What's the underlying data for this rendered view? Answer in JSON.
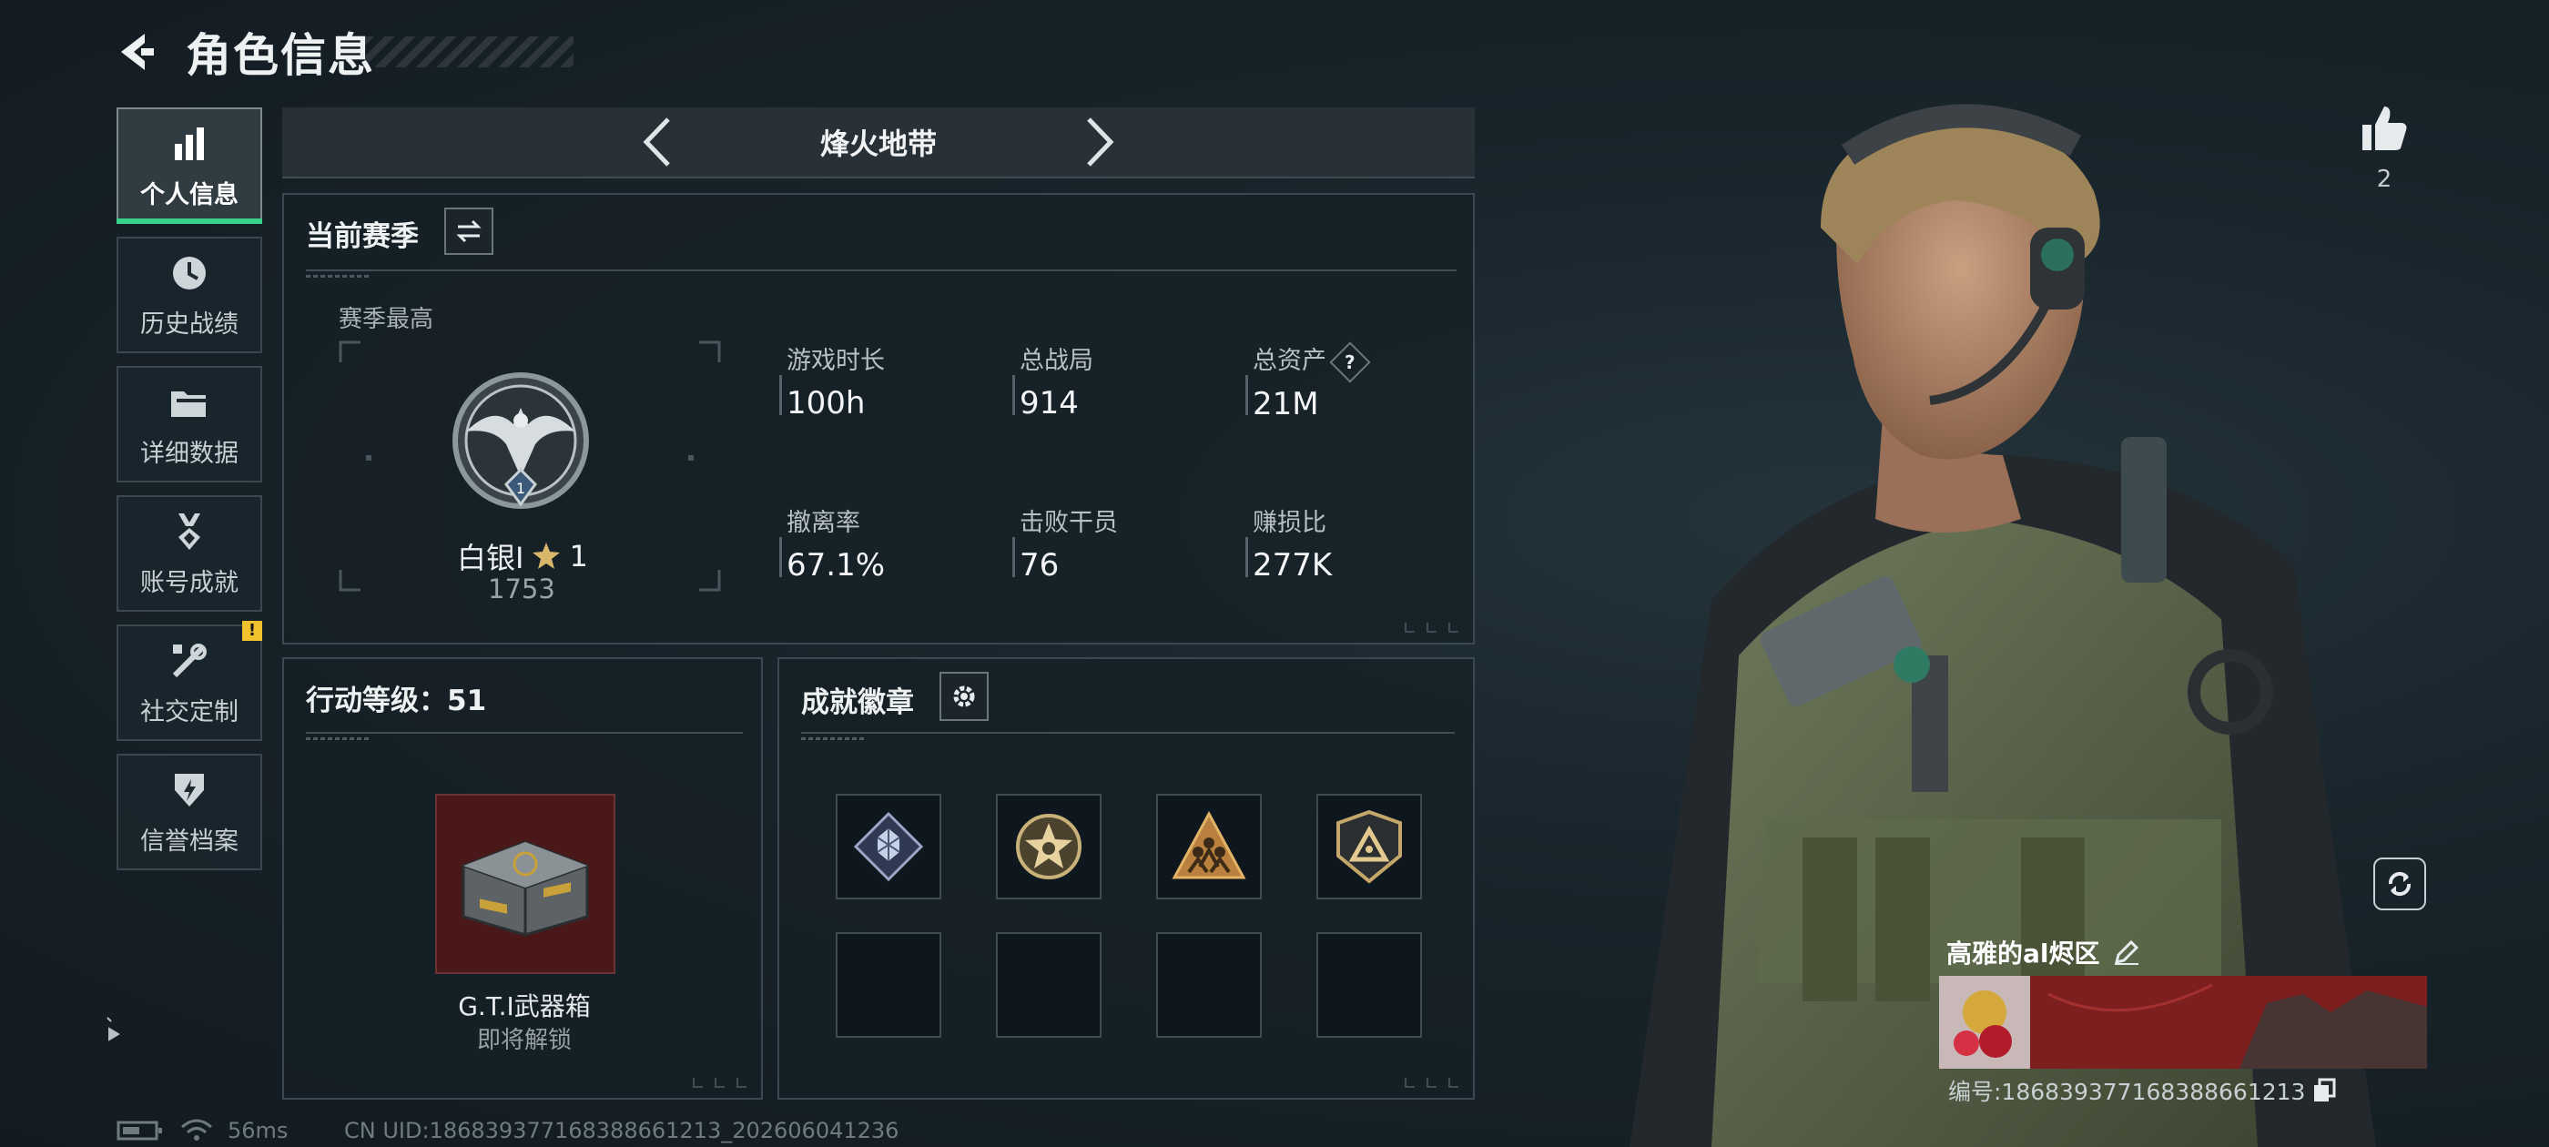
{
  "header": {
    "title": "角色信息"
  },
  "sidebar": {
    "items": [
      {
        "label": "个人信息",
        "icon": "bar-chart-icon",
        "active": true
      },
      {
        "label": "历史战绩",
        "icon": "clock-icon"
      },
      {
        "label": "详细数据",
        "icon": "folder-icon"
      },
      {
        "label": "账号成就",
        "icon": "medal-icon"
      },
      {
        "label": "社交定制",
        "icon": "tools-icon",
        "badge": "!"
      },
      {
        "label": "信誉档案",
        "icon": "shield-lightning-icon"
      }
    ]
  },
  "mode": {
    "name": "烽火地带"
  },
  "season": {
    "title": "当前赛季",
    "best_label": "赛季最高",
    "rank_name": "白银I",
    "rank_stars": "1",
    "rank_points": "1753",
    "rank_level": "1",
    "stats": [
      {
        "label": "游戏时长",
        "value": "100h"
      },
      {
        "label": "总战局",
        "value": "914"
      },
      {
        "label": "总资产",
        "value": "21M",
        "help": "?"
      },
      {
        "label": "撤离率",
        "value": "67.1%"
      },
      {
        "label": "击败干员",
        "value": "76"
      },
      {
        "label": "赚损比",
        "value": "277K"
      }
    ]
  },
  "action_level": {
    "title": "行动等级：51",
    "item_name": "G.T.I武器箱",
    "item_status": "即将解锁"
  },
  "achievements": {
    "title": "成就徽章",
    "badges": [
      "crystal-badge-icon",
      "star-badge-icon",
      "squad-badge-icon",
      "triangle-shield-badge-icon",
      "",
      "",
      "",
      ""
    ]
  },
  "profile": {
    "likes": "2",
    "player_name": "高雅的al烬区",
    "player_id": "编号:1868393771683886612​13"
  },
  "status": {
    "ping": "56ms",
    "uid": "CN UID:186839377168388661213_202606041236"
  },
  "colors": {
    "accent_green": "#37d38a",
    "warning_yellow": "#f2c12e",
    "item_red": "#4a1818"
  }
}
